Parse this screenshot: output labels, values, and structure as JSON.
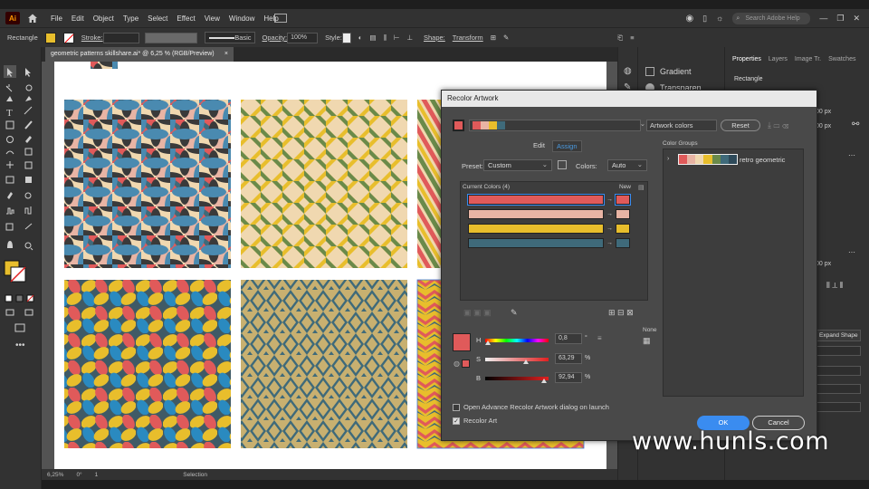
{
  "app": {
    "logo": "Ai",
    "menu": [
      "File",
      "Edit",
      "Object",
      "Type",
      "Select",
      "Effect",
      "View",
      "Window",
      "Help"
    ],
    "search_placeholder": "Search Adobe Help"
  },
  "control_bar": {
    "object_type": "Rectangle",
    "stroke_label": "Stroke:",
    "stroke_style": "Basic",
    "opacity_label": "Opacity:",
    "opacity_value": "100%",
    "style_label": "Style:",
    "shape_label": "Shape:",
    "transform_label": "Transform"
  },
  "document": {
    "tab_title": "geometric patterns skillshare.ai* @ 6,25 % (RGB/Preview)",
    "close": "×"
  },
  "status_bar": {
    "zoom": "6,25%",
    "rotation": "0°",
    "artboard": "1",
    "mode": "Selection"
  },
  "panels": {
    "left_panel": [
      "Gradient",
      "Transparen..."
    ],
    "tabs": [
      "Properties",
      "Layers",
      "Image Tr.",
      "Swatches"
    ],
    "active_tab": "Properties",
    "selection_type": "Rectangle",
    "field_a": "00 px",
    "field_b": "00 px",
    "field_c": "00 px",
    "expand_shape": "Expand Shape"
  },
  "recolor": {
    "title": "Recolor Artwork",
    "artwork_colors": "Artwork colors",
    "reset": "Reset",
    "edit_tab": "Edit",
    "assign_tab": "Assign",
    "preset_label": "Preset:",
    "preset_value": "Custom",
    "colors_label": "Colors:",
    "colors_value": "Auto",
    "current_colors": "Current Colors (4)",
    "new_label": "New",
    "rows": [
      {
        "current": "#e05a5a",
        "new": "#e05a5a"
      },
      {
        "current": "#e8b4a4",
        "new": "#e8b4a4"
      },
      {
        "current": "#e8be2c",
        "new": "#e8be2c"
      },
      {
        "current": "#3f6a7a",
        "new": "#3f6a7a"
      }
    ],
    "color_groups_label": "Color Groups",
    "group_name": "retro geometric",
    "group_swatches": [
      "#e05a5a",
      "#e8b4a4",
      "#f0d8b0",
      "#e8be2c",
      "#6a8a4a",
      "#3f6a7a",
      "#2e4a5a"
    ],
    "none_label": "None",
    "h_label": "H",
    "h_value": "0,8",
    "h_unit": "°",
    "h_level": 0.02,
    "s_label": "S",
    "s_value": "63,29",
    "s_unit": "%",
    "s_level": 0.63,
    "b_label": "B",
    "b_value": "92,94",
    "b_unit": "%",
    "b_level": 0.93,
    "active_color": "#e05a5a",
    "advanced_label": "Open Advance Recolor Artwork dialog on launch",
    "recolor_art_label": "Recolor Art",
    "ok": "OK",
    "cancel": "Cancel"
  },
  "watermark": "www.hunls.com"
}
